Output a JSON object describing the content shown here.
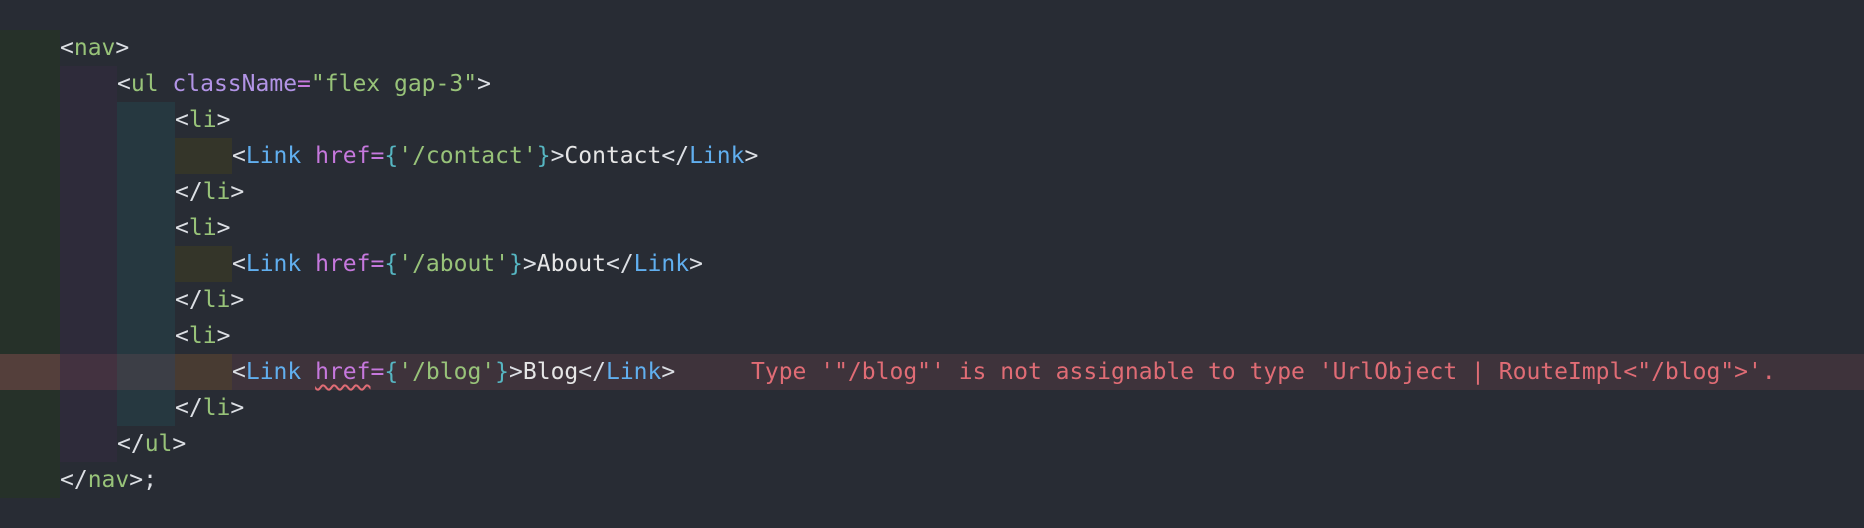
{
  "editor": {
    "language": "tsx",
    "colors": {
      "background": "#282c34",
      "tag": "#98c379",
      "component": "#61afef",
      "attribute": "#c678dd",
      "string": "#98c379",
      "brace": "#56b6c2",
      "error": "#e06c75"
    },
    "lines": {
      "l1": {
        "open": "<",
        "tag": "nav",
        "close": ">"
      },
      "l2": {
        "open": "<",
        "tag": "ul",
        "attr": "className",
        "eq": "=",
        "value": "\"flex gap-3\"",
        "close": ">"
      },
      "l3": {
        "open": "<",
        "tag": "li",
        "close": ">"
      },
      "l4": {
        "open": "<",
        "comp": "Link",
        "attr": "href",
        "eq": "=",
        "lbrace": "{",
        "value": "'/contact'",
        "rbrace": "}",
        "gt": ">",
        "text": "Contact",
        "endopen": "</",
        "endcomp": "Link",
        "endgt": ">"
      },
      "l5": {
        "open": "</",
        "tag": "li",
        "close": ">"
      },
      "l6": {
        "open": "<",
        "tag": "li",
        "close": ">"
      },
      "l7": {
        "open": "<",
        "comp": "Link",
        "attr": "href",
        "eq": "=",
        "lbrace": "{",
        "value": "'/about'",
        "rbrace": "}",
        "gt": ">",
        "text": "About",
        "endopen": "</",
        "endcomp": "Link",
        "endgt": ">"
      },
      "l8": {
        "open": "</",
        "tag": "li",
        "close": ">"
      },
      "l9": {
        "open": "<",
        "tag": "li",
        "close": ">"
      },
      "l10": {
        "open": "<",
        "comp": "Link",
        "attr": "href",
        "eq": "=",
        "lbrace": "{",
        "value": "'/blog'",
        "rbrace": "}",
        "gt": ">",
        "text": "Blog",
        "endopen": "</",
        "endcomp": "Link",
        "endgt": ">"
      },
      "l11": {
        "open": "</",
        "tag": "li",
        "close": ">"
      },
      "l12": {
        "open": "</",
        "tag": "ul",
        "close": ">"
      },
      "l13": {
        "open": "</",
        "tag": "nav",
        "close": ">;"
      }
    },
    "diagnostic": {
      "message": "Type '\"/blog\"' is not assignable to type 'UrlObject | RouteImpl<\"/blog\">'."
    }
  }
}
